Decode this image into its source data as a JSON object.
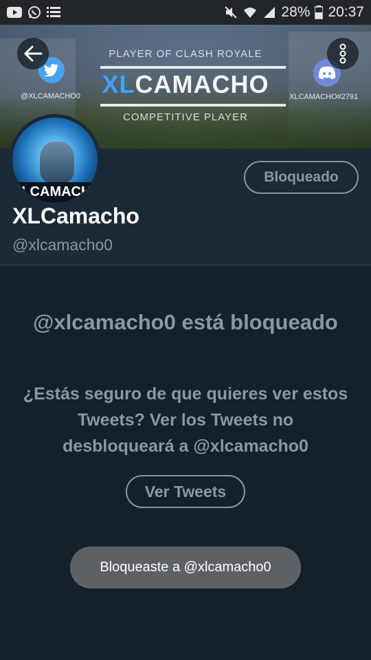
{
  "status_bar": {
    "battery_percent": "28%",
    "time": "20:37",
    "left_icons": [
      "youtube-icon",
      "whatsapp-icon",
      "notification-list-icon"
    ],
    "right_icons": [
      "mute-icon",
      "wifi-icon",
      "signal-icon",
      "battery-icon"
    ]
  },
  "banner": {
    "top_text": "PLAYER OF CLASH ROYALE",
    "title_xl": "XL",
    "title_rest": "CAMACHO",
    "bottom_text": "COMPETITIVE PLAYER",
    "twitter_handle": "@XLCAMACHO0",
    "discord_handle": "XLCAMACHO#2791"
  },
  "profile": {
    "avatar_text": "XLCAMACHO",
    "name": "XLCamacho",
    "handle": "@xlcamacho0",
    "blocked_button_label": "Bloqueado"
  },
  "blocked_message": {
    "title": "@xlcamacho0 está bloqueado",
    "body": "¿Estás seguro de que quieres ver estos Tweets? Ver los Tweets no desbloqueará a @xlcamacho0",
    "view_button_label": "Ver Tweets"
  },
  "toast": {
    "text": "Bloqueaste a @xlcamacho0"
  },
  "colors": {
    "background": "#15202b",
    "header_background": "#1c2938",
    "secondary_text": "#8899a6",
    "toast_background": "#5d6166"
  }
}
